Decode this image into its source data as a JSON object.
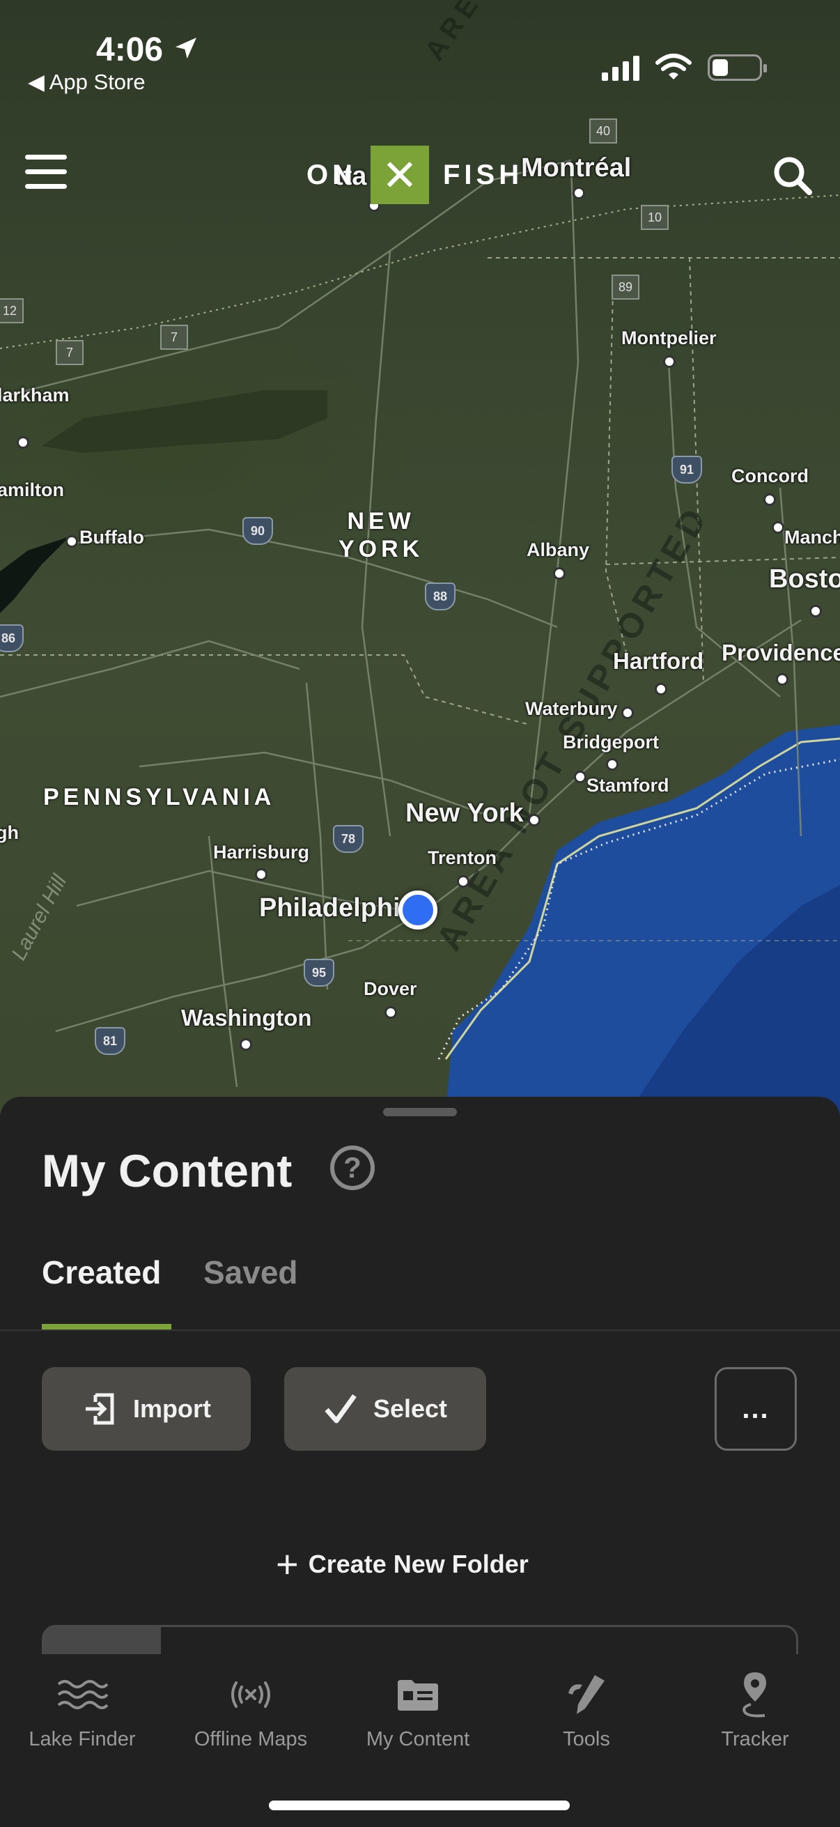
{
  "status_bar": {
    "time": "4:06",
    "back_label": "◀ App Store"
  },
  "header": {
    "logo_left": "ON",
    "logo_mark": "✕",
    "logo_right": "FISH"
  },
  "map": {
    "cities": [
      {
        "name": "Montréal",
        "big": false
      },
      {
        "name": "Montpelier",
        "big": false
      },
      {
        "name": "Concord",
        "big": false
      },
      {
        "name": "Manch",
        "big": false
      },
      {
        "name": "Bosto",
        "big": true
      },
      {
        "name": "Providence",
        "big": false
      },
      {
        "name": "Hartford",
        "big": false
      },
      {
        "name": "Waterbury",
        "big": false
      },
      {
        "name": "Bridgeport",
        "big": false
      },
      {
        "name": "Stamford",
        "big": false
      },
      {
        "name": "Albany",
        "big": false
      },
      {
        "name": "Buffalo",
        "big": false
      },
      {
        "name": "larkham",
        "big": false
      },
      {
        "name": "amilton",
        "big": false
      },
      {
        "name": "New York",
        "big": true
      },
      {
        "name": "Trenton",
        "big": false
      },
      {
        "name": "Harrisburg",
        "big": false
      },
      {
        "name": "Philadelphi",
        "big": true
      },
      {
        "name": "Dover",
        "big": false
      },
      {
        "name": "Washington",
        "big": false
      },
      {
        "name": "gh",
        "big": false
      }
    ],
    "states": [
      "NEW\nYORK",
      "PENNSYLVANIA"
    ],
    "area_label": "AREA NOT SUPPORTED",
    "area_label_top": "AREA",
    "shields": [
      "90",
      "88",
      "78",
      "95",
      "81",
      "91",
      "86"
    ],
    "route_squares": [
      "7",
      "7",
      "12",
      "40",
      "10",
      "89"
    ],
    "terrain_label": "Laurel Hill",
    "ottawa_fragment": "tta"
  },
  "sheet": {
    "title": "My Content",
    "help_icon": "?",
    "tabs": [
      "Created",
      "Saved"
    ],
    "import_label": "Import",
    "select_label": "Select",
    "more_label": "...",
    "create_folder_label": "Create New Folder",
    "create_folder_icon": "+"
  },
  "tabbar": {
    "items": [
      {
        "label": "Lake Finder",
        "icon": "waves-icon"
      },
      {
        "label": "Offline Maps",
        "icon": "offline-signal-icon"
      },
      {
        "label": "My Content",
        "icon": "folder-card-icon"
      },
      {
        "label": "Tools",
        "icon": "tools-icon"
      },
      {
        "label": "Tracker",
        "icon": "tracker-pin-icon"
      }
    ]
  },
  "colors": {
    "brand_green": "#7ba338",
    "sheet_bg": "#212121",
    "button_bg": "#4b4a47",
    "location_blue": "#2f6df2",
    "water": "#1d4a9a"
  }
}
